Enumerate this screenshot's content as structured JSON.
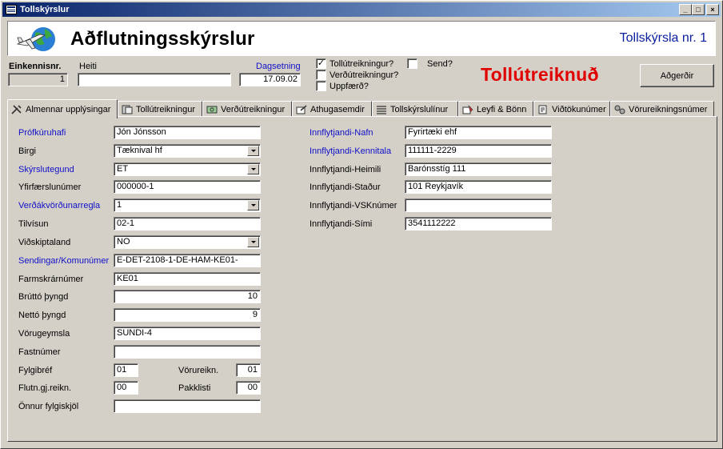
{
  "window": {
    "title": "Tollskýrslur",
    "minimize": "_",
    "maximize": "□",
    "close": "×"
  },
  "header": {
    "title": "Aðflutningsskýrslur",
    "report_no": "Tollskýrsla nr. 1",
    "logo": "airplane-globe-icon"
  },
  "top": {
    "einkennisnr_label": "Einkennisnr.",
    "einkennisnr_value": "1",
    "heiti_label": "Heiti",
    "heiti_value": "",
    "dagsetning_label": "Dagsetning",
    "dagsetning_value": "17.09.02",
    "checks": [
      {
        "label": "Tollútreikningur?",
        "checked": true,
        "mark": "✓"
      },
      {
        "label": "Verðútreikningur?",
        "checked": false,
        "mark": ""
      },
      {
        "label": "Uppfærð?",
        "checked": false,
        "mark": ""
      },
      {
        "label": "Send?",
        "checked": false,
        "mark": ""
      }
    ],
    "status": "Tollútreiknuð",
    "action_button": "Aðgerðir"
  },
  "tabs": [
    {
      "label": "Almennar upplýsingar",
      "icon": "tools-icon",
      "active": true
    },
    {
      "label": "Tollútreikningur",
      "icon": "calculator-icon",
      "active": false
    },
    {
      "label": "Verðútreikningur",
      "icon": "money-icon",
      "active": false
    },
    {
      "label": "Athugasemdir",
      "icon": "notes-icon",
      "active": false
    },
    {
      "label": "Tollskýrslulínur",
      "icon": "list-icon",
      "active": false
    },
    {
      "label": "Leyfi & Bönn",
      "icon": "permit-icon",
      "active": false
    },
    {
      "label": "Viðtökunúmer",
      "icon": "receipt-icon",
      "active": false
    },
    {
      "label": "Vörureikningsnúmer",
      "icon": "invoice-icon",
      "active": false
    }
  ],
  "left_form": {
    "profkuruhafi": {
      "label": "Prófkúruhafi",
      "value": "Jón Jónsson"
    },
    "birgi": {
      "label": "Birgi",
      "value": "Tæknival hf"
    },
    "skyrslutegund": {
      "label": "Skýrslutegund",
      "value": "ET"
    },
    "yfirfaerslunumer": {
      "label": "Yfirfærslunúmer",
      "value": "000000-1"
    },
    "verdakvordunarregla": {
      "label": "Verðákvörðunarregla",
      "value": "1"
    },
    "tilvisun": {
      "label": "Tilvísun",
      "value": "02-1"
    },
    "vidskiptaland": {
      "label": "Viðskiptaland",
      "value": "NO"
    },
    "sendingar": {
      "label": "Sendingar/Komunúmer",
      "value": "E-DET-2108-1-DE-HAM-KE01-"
    },
    "farmskrarnumer": {
      "label": "Farmskrárnúmer",
      "value": "KE01"
    },
    "brutto": {
      "label": "Brúttó þyngd",
      "value": "10"
    },
    "netto": {
      "label": "Nettó þyngd",
      "value": "9"
    },
    "vorugeymsla": {
      "label": "Vörugeymsla",
      "value": "SUNDI-4"
    },
    "fastnumer": {
      "label": "Fastnúmer",
      "value": ""
    },
    "fylgibref": {
      "label": "Fylgibréf",
      "value": "01"
    },
    "vorureikn": {
      "label": "Vörureikn.",
      "value": "01"
    },
    "flutn": {
      "label": "Flutn.gj.reikn.",
      "value": "00"
    },
    "pakklisti": {
      "label": "Pakklisti",
      "value": "00"
    },
    "onnur": {
      "label": "Önnur fylgiskjöl",
      "value": ""
    }
  },
  "right_form": {
    "nafn": {
      "label": "Innflytjandi-Nafn",
      "value": "Fyrirtæki ehf"
    },
    "kennitala": {
      "label": "Innflytjandi-Kennitala",
      "value": "111111-2229"
    },
    "heimili": {
      "label": "Innflytjandi-Heimili",
      "value": "Barónsstíg 111"
    },
    "stadur": {
      "label": "Innflytjandi-Staður",
      "value": "101 Reykjavík"
    },
    "vsknumer": {
      "label": "Innflytjandi-VSKnúmer",
      "value": ""
    },
    "simi": {
      "label": "Innflytjandi-Sími",
      "value": "3541112222"
    }
  },
  "colors": {
    "accent_blue": "#1010c8",
    "status_red": "#e00000",
    "title_bar": "#0a246a"
  }
}
